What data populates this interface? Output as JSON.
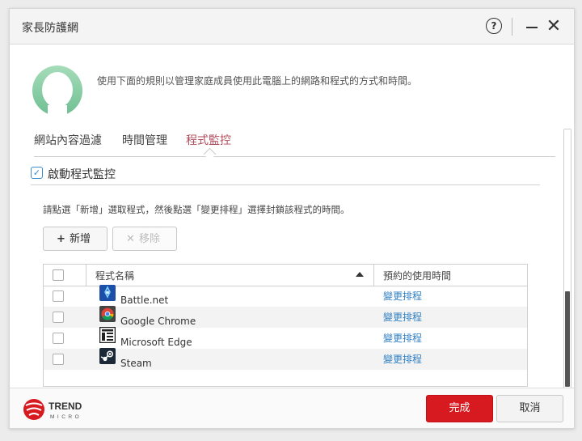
{
  "window": {
    "title": "家長防護網",
    "help_label": "?",
    "close_label": "✕"
  },
  "header": {
    "description": "使用下面的規則以管理家庭成員使用此電腦上的網路和程式的方式和時間。"
  },
  "tabs": [
    {
      "label": "網站內容過濾",
      "active": false
    },
    {
      "label": "時間管理",
      "active": false
    },
    {
      "label": "程式監控",
      "active": true
    }
  ],
  "program_control": {
    "enable_label": "啟動程式監控",
    "enabled": true,
    "instructions": "請點選「新增」選取程式，然後點選「變更排程」選擇封鎖該程式的時間。",
    "add_label": "新增",
    "remove_label": "移除",
    "columns": {
      "name": "程式名稱",
      "schedule": "預約的使用時間"
    },
    "rows": [
      {
        "name": "Battle.net",
        "icon": "battlenet-icon",
        "schedule_link": "變更排程"
      },
      {
        "name": "Google Chrome",
        "icon": "chrome-icon",
        "schedule_link": "變更排程"
      },
      {
        "name": "Microsoft Edge",
        "icon": "edge-icon",
        "schedule_link": "變更排程"
      },
      {
        "name": "Steam",
        "icon": "steam-icon",
        "schedule_link": "變更排程"
      }
    ]
  },
  "footer": {
    "brand_line1": "TREND",
    "brand_line2": "MICRO",
    "done_label": "完成",
    "cancel_label": "取消"
  },
  "colors": {
    "accent_red": "#d71920",
    "active_tab": "#b04a5a",
    "link_blue": "#2f7fc4",
    "avatar_green": "#8ccfa8"
  }
}
